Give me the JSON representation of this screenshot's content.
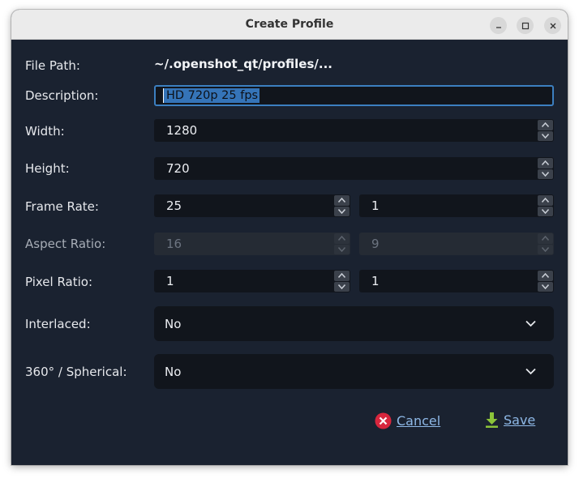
{
  "window": {
    "title": "Create Profile",
    "controls": [
      "minimize-icon",
      "maximize-icon",
      "close-icon"
    ]
  },
  "form": {
    "file_path": {
      "label": "File Path:",
      "value": "~/.openshot_qt/profiles/..."
    },
    "description": {
      "label": "Description:",
      "value": "HD 720p 25 fps"
    },
    "width": {
      "label": "Width:",
      "value": "1280"
    },
    "height": {
      "label": "Height:",
      "value": "720"
    },
    "frame_rate": {
      "label": "Frame Rate:",
      "num": "25",
      "den": "1"
    },
    "aspect_ratio": {
      "label": "Aspect Ratio:",
      "num": "16",
      "den": "9",
      "enabled": false
    },
    "pixel_ratio": {
      "label": "Pixel Ratio:",
      "num": "1",
      "den": "1"
    },
    "interlaced": {
      "label": "Interlaced:",
      "value": "No"
    },
    "spherical": {
      "label": "360° / Spherical:",
      "value": "No"
    }
  },
  "buttons": {
    "cancel": {
      "label": "Cancel",
      "icon": "cancel-icon",
      "color": "#d7263d"
    },
    "save": {
      "label": "Save",
      "icon": "download-arrow-icon",
      "color": "#8cc43a"
    }
  },
  "colors": {
    "dialog_bg": "#1a2230",
    "field_bg": "#11151c",
    "accent": "#3c7fc0"
  }
}
